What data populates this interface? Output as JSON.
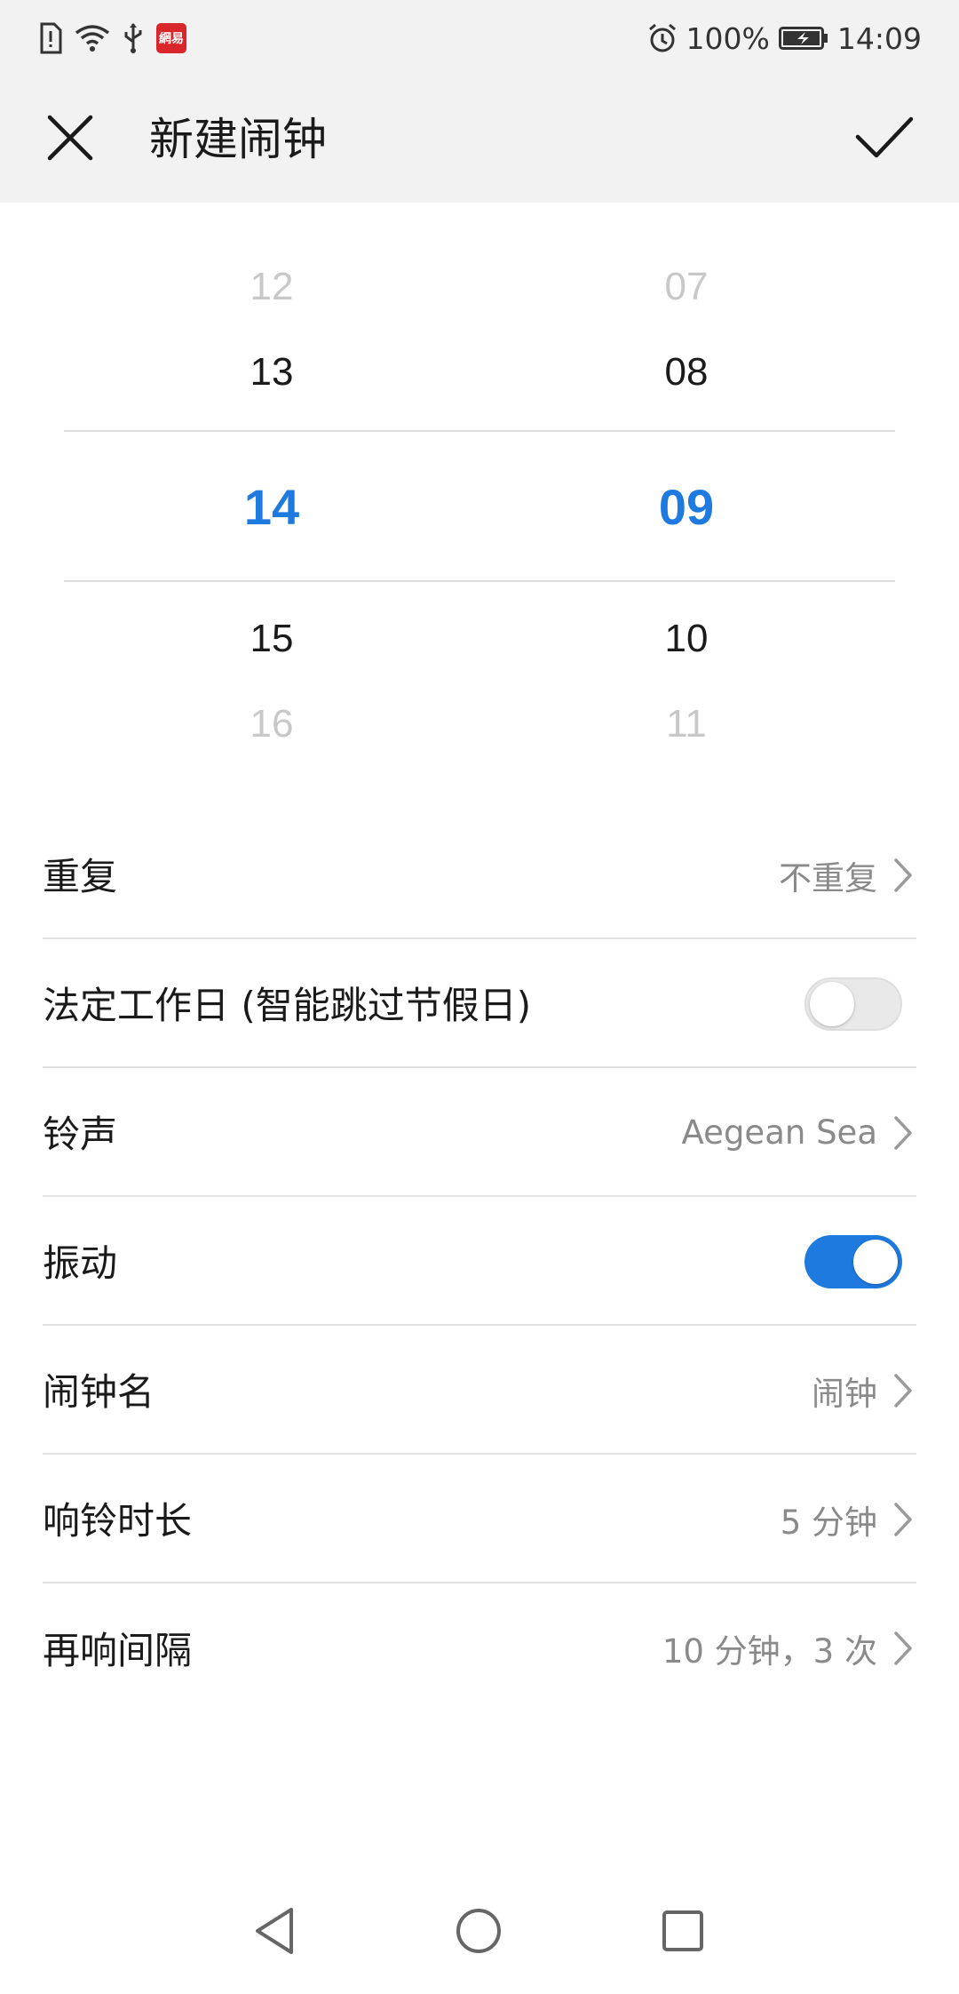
{
  "status_bar": {
    "battery": "100%",
    "time": "14:09",
    "app_badge_text": "網易"
  },
  "app_bar": {
    "title": "新建闹钟"
  },
  "picker": {
    "hours": [
      "12",
      "13",
      "14",
      "15",
      "16"
    ],
    "minutes": [
      "07",
      "08",
      "09",
      "10",
      "11"
    ],
    "selected_hour": "14",
    "selected_minute": "09",
    "accent_color": "#1f7ae0"
  },
  "settings": {
    "repeat": {
      "label": "重复",
      "value": "不重复"
    },
    "workday": {
      "label": "法定工作日 (智能跳过节假日)",
      "enabled": false
    },
    "ringtone": {
      "label": "铃声",
      "value": "Aegean Sea"
    },
    "vibrate": {
      "label": "振动",
      "enabled": true
    },
    "name": {
      "label": "闹钟名",
      "value": "闹钟"
    },
    "duration": {
      "label": "响铃时长",
      "value": "5 分钟"
    },
    "snooze": {
      "label": "再响间隔",
      "value": "10 分钟，3 次"
    }
  },
  "icons": {
    "close": "close-icon",
    "confirm": "check-icon",
    "chevron": "chevron-right-icon",
    "nav_back": "triangle-back-icon",
    "nav_home": "circle-home-icon",
    "nav_recent": "square-recent-icon"
  }
}
